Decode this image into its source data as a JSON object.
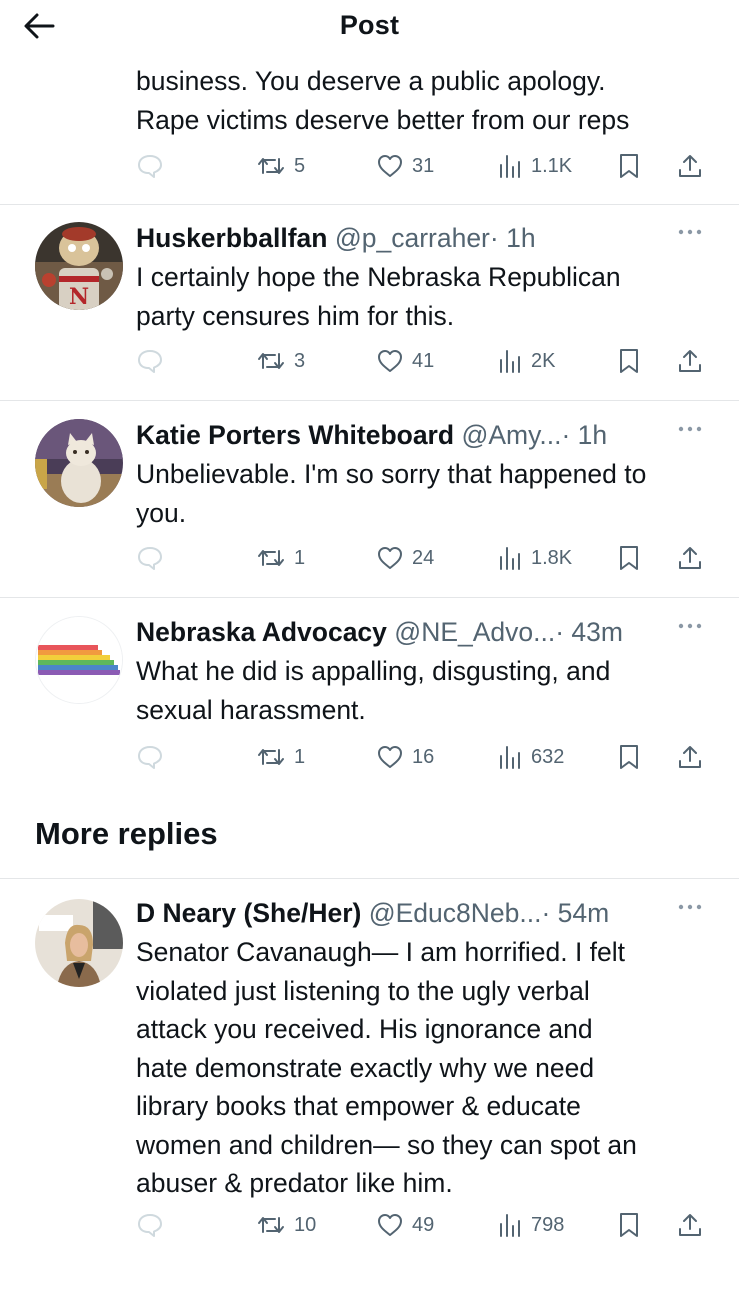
{
  "header": {
    "title": "Post",
    "back_label": "Back"
  },
  "tweets": [
    {
      "text_lines": [
        "business. You deserve a public apology.",
        "Rape victims deserve better from our reps"
      ],
      "retweets": "5",
      "likes": "31",
      "views": "1.1K"
    },
    {
      "name": "Huskerbballfan",
      "handle": "@p_carraher",
      "time": "· 1h",
      "text_lines": [
        "I certainly hope the Nebraska Republican",
        "party censures him for this."
      ],
      "retweets": "3",
      "likes": "41",
      "views": "2K"
    },
    {
      "name": "Katie Porters Whiteboard",
      "handle": "@Amy...",
      "time": "· 1h",
      "text_lines": [
        "Unbelievable. I'm so sorry that happened to",
        "you."
      ],
      "retweets": "1",
      "likes": "24",
      "views": "1.8K"
    },
    {
      "name": "Nebraska Advocacy",
      "handle": "@NE_Advo...",
      "time": "· 43m",
      "text_lines": [
        "What he did is appalling, disgusting, and",
        "sexual harassment."
      ],
      "retweets": "1",
      "likes": "16",
      "views": "632"
    },
    {
      "name": "D Neary (She/Her)",
      "handle": "@Educ8Neb...",
      "time": "· 54m",
      "text_lines": [
        "Senator Cavanaugh— I am horrified.  I felt",
        "violated just listening to the ugly verbal",
        "attack you received. His ignorance and",
        "hate demonstrate exactly why we need",
        "library books that empower & educate",
        "women and children— so they can spot an",
        "abuser & predator like him."
      ],
      "retweets": "10",
      "likes": "49",
      "views": "798"
    }
  ],
  "more_replies_label": "More replies",
  "icons": {
    "reply": "comment-bubble-icon",
    "retweet": "retweet-icon",
    "like": "heart-icon",
    "views": "views-bar-chart-icon",
    "bookmark": "bookmark-icon",
    "share": "share-upload-icon"
  },
  "colors": {
    "text": "#0f1419",
    "secondary": "#536471",
    "divider": "#e4e6e8",
    "reply_icon": "#cfd9de"
  }
}
